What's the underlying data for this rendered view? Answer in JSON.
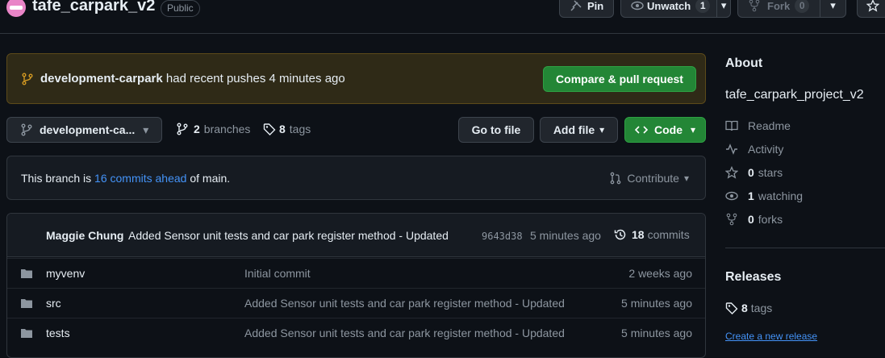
{
  "repo": {
    "name": "tafe_carpark_v2",
    "visibility": "Public"
  },
  "header_actions": {
    "pin_label": "Pin",
    "unwatch_label": "Unwatch",
    "watch_count": "1",
    "fork_label": "Fork",
    "fork_count": "0"
  },
  "push_banner": {
    "branch": "development-carpark",
    "message": "had recent pushes 4 minutes ago",
    "button_label": "Compare & pull request"
  },
  "branch_bar": {
    "current_branch": "development-ca...",
    "branch_count": "2",
    "branch_label": "branches",
    "tag_count": "8",
    "tag_label": "tags",
    "goto_file_label": "Go to file",
    "add_file_label": "Add file",
    "code_label": "Code"
  },
  "branch_status": {
    "prefix": "This branch is",
    "ahead_link": "16 commits ahead",
    "suffix": "of main.",
    "contribute_label": "Contribute"
  },
  "latest_commit": {
    "author": "Maggie Chung",
    "message": "Added Sensor unit tests and car park register method - Updated",
    "sha": "9643d38",
    "time": "5 minutes ago",
    "commit_count": "18",
    "commit_label": "commits"
  },
  "files": [
    {
      "name": "myvenv",
      "commit": "Initial commit",
      "time": "2 weeks ago"
    },
    {
      "name": "src",
      "commit": "Added Sensor unit tests and car park register method - Updated",
      "time": "5 minutes ago"
    },
    {
      "name": "tests",
      "commit": "Added Sensor unit tests and car park register method - Updated",
      "time": "5 minutes ago"
    }
  ],
  "about": {
    "title": "About",
    "description": "tafe_carpark_project_v2",
    "readme_label": "Readme",
    "activity_label": "Activity",
    "stars_count": "0",
    "stars_label": "stars",
    "watching_count": "1",
    "watching_label": "watching",
    "forks_count": "0",
    "forks_label": "forks"
  },
  "releases": {
    "title": "Releases",
    "tags_count": "8",
    "tags_label": "tags",
    "create_link": "Create a new release"
  },
  "colors": {
    "background": "#0d1117",
    "green_button": "#238636",
    "link": "#4493f8",
    "banner_bg": "#2f2a17"
  }
}
